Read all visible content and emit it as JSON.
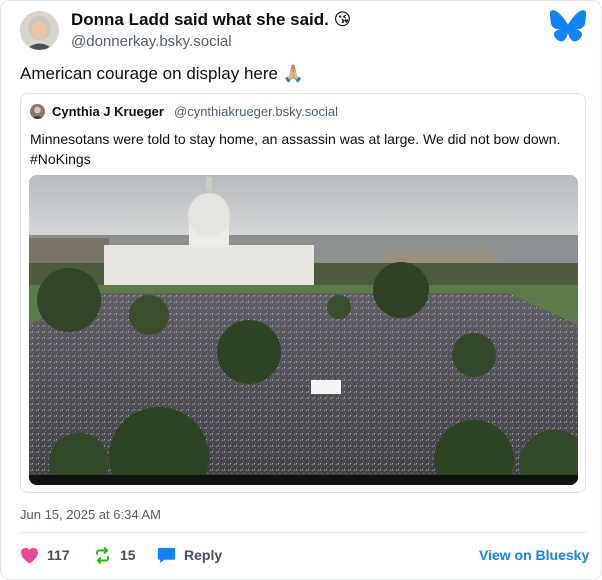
{
  "colors": {
    "accent": "#1083fe",
    "like": "#ec4899",
    "repost": "#20bc07",
    "reply": "#1083fe",
    "muted": "#52606d"
  },
  "post": {
    "author_name": "Donna Ladd said what she said. 😘",
    "author_handle": "@donnerkay.bsky.social",
    "text": "American courage on display here 🙏🏼",
    "timestamp": "Jun 15, 2025 at 6:34 AM"
  },
  "quote": {
    "author_name": "Cynthia J Krueger",
    "author_handle": "@cynthiakrueger.bsky.social",
    "text": "Minnesotans were told to stay home, an assassin was at large. We did not bow down. #NoKings"
  },
  "actions": {
    "likes": "117",
    "reposts": "15",
    "reply_label": "Reply",
    "view_label": "View on Bluesky"
  },
  "icons": {
    "logo": "bluesky-butterfly-icon",
    "like": "heart-icon",
    "repost": "repost-icon",
    "reply": "reply-bubble-icon"
  }
}
